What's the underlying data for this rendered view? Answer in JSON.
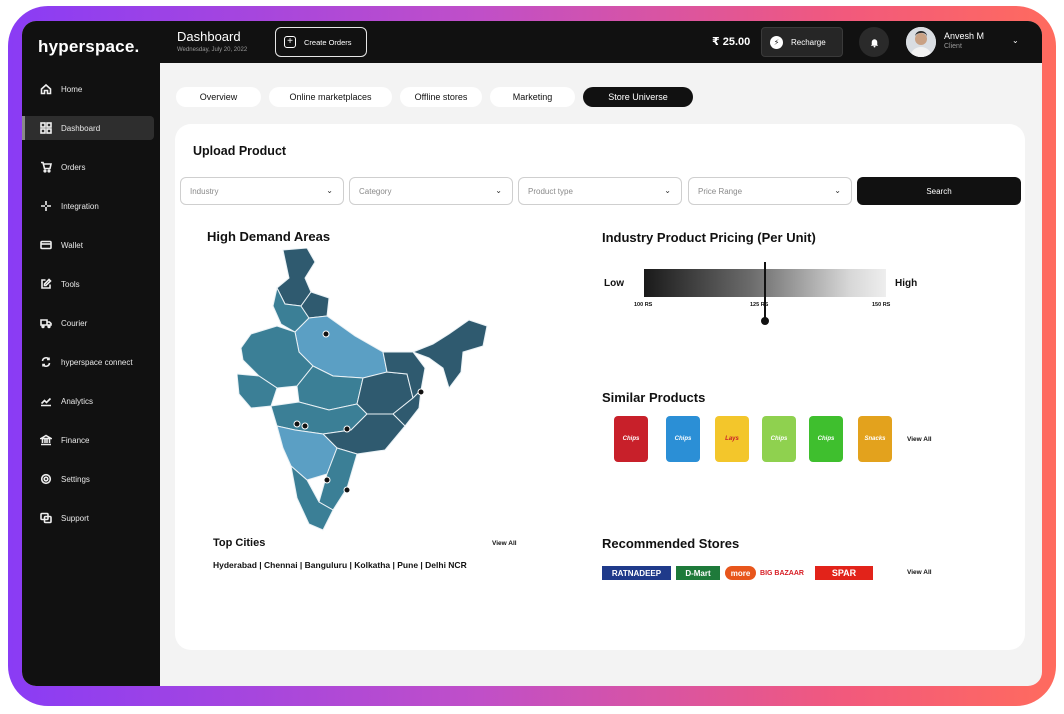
{
  "sidebar": {
    "logo": "hyperspace.",
    "items": [
      {
        "label": "Home",
        "icon": "home-icon"
      },
      {
        "label": "Dashboard",
        "icon": "grid-icon",
        "active": true
      },
      {
        "label": "Orders",
        "icon": "cart-icon"
      },
      {
        "label": "Integration",
        "icon": "integration-icon"
      },
      {
        "label": "Wallet",
        "icon": "wallet-icon"
      },
      {
        "label": "Tools",
        "icon": "edit-icon"
      },
      {
        "label": "Courier",
        "icon": "truck-icon"
      },
      {
        "label": "hyperspace connect",
        "icon": "sync-icon"
      },
      {
        "label": "Analytics",
        "icon": "chart-icon"
      },
      {
        "label": "Finance",
        "icon": "bank-icon"
      },
      {
        "label": "Settings",
        "icon": "gear-icon"
      },
      {
        "label": "Support",
        "icon": "support-icon"
      }
    ]
  },
  "header": {
    "title": "Dashboard",
    "date": "Wednesday, July 20, 2022",
    "create_orders": "Create Orders",
    "balance": "₹ 25.00",
    "recharge": "Recharge",
    "user_name": "Anvesh M",
    "user_role": "Client"
  },
  "tabs": [
    "Overview",
    "Online marketplaces",
    "Offline stores",
    "Marketing",
    "Store Universe"
  ],
  "active_tab": "Store Universe",
  "upload": {
    "title": "Upload Product",
    "filters": [
      "Industry",
      "Category",
      "Product type",
      "Price Range"
    ],
    "search": "Search"
  },
  "demand": {
    "title": "High Demand Areas",
    "top_cities_title": "Top Cities",
    "view_all": "View All",
    "cities": "Hyderabad | Chennai | Banguluru | Kolkatha | Pune | Delhi NCR"
  },
  "pricing": {
    "title": "Industry Product Pricing (Per Unit)",
    "low": "Low",
    "high": "High",
    "ticks": [
      "100 RS",
      "125 RS",
      "150 RS"
    ],
    "min": 100,
    "max": 150,
    "marker_value": 125
  },
  "similar": {
    "title": "Similar Products",
    "view_all": "View All",
    "products": [
      {
        "label": "Chips",
        "color": "#c8202a"
      },
      {
        "label": "Chips",
        "color": "#2b8fd6"
      },
      {
        "label": "Lays",
        "color": "#f3c62b"
      },
      {
        "label": "Chips",
        "color": "#8fd14f"
      },
      {
        "label": "Chips",
        "color": "#3fbf2e"
      },
      {
        "label": "Snacks",
        "color": "#e3a21d"
      }
    ]
  },
  "stores": {
    "title": "Recommended Stores",
    "view_all": "View All",
    "items": [
      {
        "label": "RATNADEEP",
        "color": "#1f3a8a"
      },
      {
        "label": "D-Mart",
        "color": "#1e7a3a"
      },
      {
        "label": "more",
        "color": "#e8561c"
      },
      {
        "label": "BIG BAZAAR",
        "color": "#d71c23"
      },
      {
        "label": "SPAR",
        "color": "#e2231a"
      }
    ]
  },
  "colors": {
    "sidebar_bg": "#111111",
    "map_dark": "#2f5a6f",
    "map_mid": "#3b7f96",
    "map_light": "#5b9fc4"
  }
}
